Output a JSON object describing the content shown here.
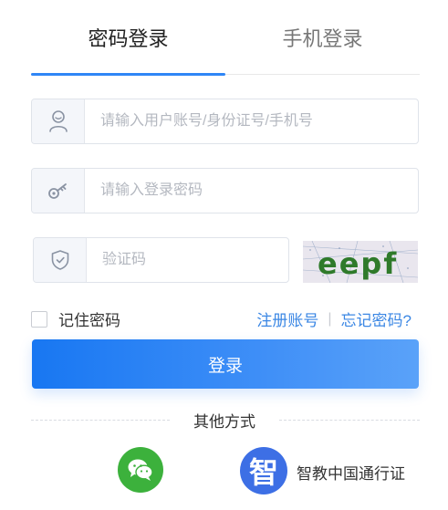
{
  "tabs": {
    "password_login": "密码登录",
    "phone_login": "手机登录"
  },
  "form": {
    "username_placeholder": "请输入用户账号/身份证号/手机号",
    "password_placeholder": "请输入登录密码",
    "captcha_placeholder": "验证码",
    "captcha_text": "eepf"
  },
  "options": {
    "remember_label": "记住密码",
    "register_link": "注册账号",
    "separator": "|",
    "forgot_link": "忘记密码?"
  },
  "login_button": "登录",
  "other": {
    "title": "其他方式",
    "wechat_icon": "wechat-icon",
    "zhijiao_glyph": "智",
    "zhijiao_label": "智教中国通行证"
  },
  "colors": {
    "accent": "#2f86f6",
    "link": "#3b87e4",
    "wechat": "#3cb13c",
    "zhijiao": "#3d6fe5"
  }
}
